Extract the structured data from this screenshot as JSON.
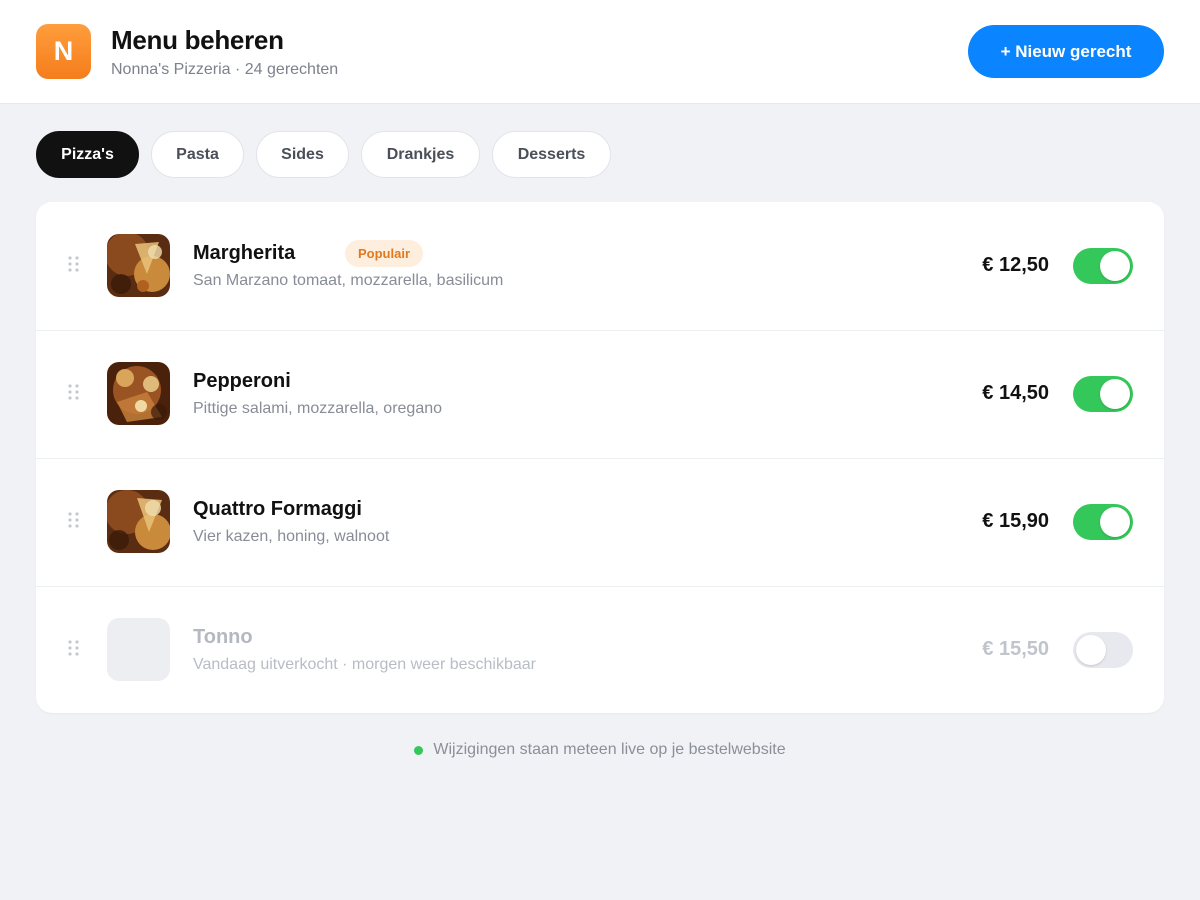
{
  "header": {
    "logo_letter": "N",
    "title": "Menu beheren",
    "subtitle": "Nonna's Pizzeria · 24 gerechten",
    "new_button_label": "+ Nieuw gerecht"
  },
  "tabs": [
    {
      "label": "Pizza's",
      "active": true
    },
    {
      "label": "Pasta",
      "active": false
    },
    {
      "label": "Sides",
      "active": false
    },
    {
      "label": "Drankjes",
      "active": false
    },
    {
      "label": "Desserts",
      "active": false
    }
  ],
  "items": [
    {
      "name": "Margherita",
      "badge": "Populair",
      "description": "San Marzano tomaat, mozzarella, basilicum",
      "price": "€ 12,50",
      "available": true
    },
    {
      "name": "Pepperoni",
      "description": "Pittige salami, mozzarella, oregano",
      "price": "€ 14,50",
      "available": true
    },
    {
      "name": "Quattro Formaggi",
      "description": "Vier kazen, honing, walnoot",
      "price": "€ 15,90",
      "available": true
    },
    {
      "name": "Tonno",
      "description": "Vandaag uitverkocht · morgen weer beschikbaar",
      "price": "€ 15,50",
      "available": false
    }
  ],
  "footer": {
    "status_text": "Wijzigingen staan meteen live op je bestelwebsite"
  },
  "colors": {
    "accent": "#0a84ff",
    "brand": "#f5841f",
    "toggle_on": "#34c759",
    "badge_text": "#e17a1f"
  }
}
